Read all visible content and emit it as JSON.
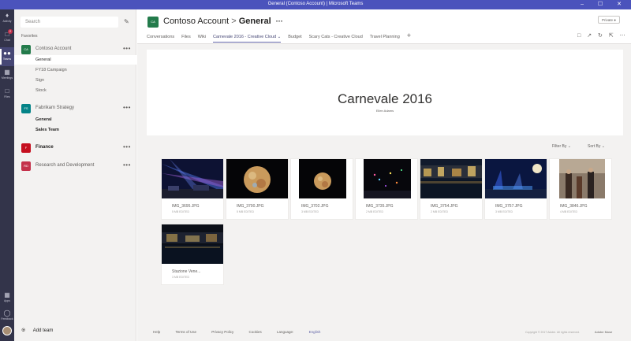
{
  "window": {
    "title": "General (Contoso Account) | Microsoft Teams",
    "controls": "– ☐ ✕"
  },
  "rail": {
    "items": [
      {
        "label": "Activity",
        "icon": "bell-icon"
      },
      {
        "label": "Chat",
        "icon": "chat-icon",
        "badge": "2"
      },
      {
        "label": "Teams",
        "icon": "teams-icon",
        "active": true
      },
      {
        "label": "Meetings",
        "icon": "calendar-icon"
      },
      {
        "label": "Files",
        "icon": "files-icon"
      },
      {
        "label": "Apps",
        "icon": "apps-icon"
      },
      {
        "label": "Feedback",
        "icon": "feedback-icon"
      }
    ]
  },
  "sidebar": {
    "search_placeholder": "Search",
    "favorites_label": "Favorites",
    "teams": [
      {
        "name": "Contoso Account",
        "tile": "CA",
        "color": "#237b4b",
        "channels": [
          "General",
          "FY18 Campaign",
          "Sign",
          "Stock"
        ]
      },
      {
        "name": "Fabrikam Strategy",
        "tile": "FS",
        "color": "#038387",
        "channels": [
          "General",
          "Sales Team"
        ]
      },
      {
        "name": "Finance",
        "tile": "F",
        "color": "#c50f1f",
        "channels": []
      },
      {
        "name": "Research and Development",
        "tile": "RD",
        "color": "#c4314b",
        "channels": []
      }
    ],
    "add_team": "Add team"
  },
  "header": {
    "team": "Contoso Account",
    "separator": ">",
    "channel": "General",
    "more": "···",
    "private_label": "Private",
    "tabs": [
      "Conversations",
      "Files",
      "Wiki",
      "Carnevale 2016 - Creative Cloud ⌄",
      "Budget",
      "Scary Cats - Creative Cloud",
      "Travel Planning"
    ],
    "add_tab": "+"
  },
  "banner": {
    "title": "Carnevale 2016",
    "author": "Ellen Adams"
  },
  "controls": {
    "filter": "Filter By ⌄",
    "sort": "Sort By ⌄"
  },
  "gallery": [
    {
      "name": "IMG_3695.JPG",
      "meta": "5 MB EDITED",
      "scene": "lasers"
    },
    {
      "name": "IMG_3700.JPG",
      "meta": "5 MB EDITED",
      "scene": "moon"
    },
    {
      "name": "IMG_3702.JPG",
      "meta": "3 MB EDITED",
      "scene": "moon-small"
    },
    {
      "name": "IMG_3735.JPG",
      "meta": "2 MB EDITED",
      "scene": "fireworks"
    },
    {
      "name": "IMG_3754.JPG",
      "meta": "2 MB EDITED",
      "scene": "river"
    },
    {
      "name": "IMG_3757.JPG",
      "meta": "3 MB EDITED",
      "scene": "lights-moon"
    },
    {
      "name": "IMG_3846.JPG",
      "meta": "4 MB EDITED",
      "scene": "street"
    },
    {
      "name": "Stazione Vene...",
      "meta": "3 MB EDITED",
      "scene": "station"
    }
  ],
  "footer": {
    "links": [
      "Help",
      "Terms of Use",
      "Privacy Policy",
      "Cookies"
    ],
    "language_label": "Language:",
    "language": "English",
    "copyright": "Copyright © 2017 Adobe. All rights reserved.",
    "brand": "Adobe Muse"
  },
  "colors": {
    "rail": "#33344a",
    "accent": "#6264a7",
    "titlebar": "#4b53bc"
  }
}
